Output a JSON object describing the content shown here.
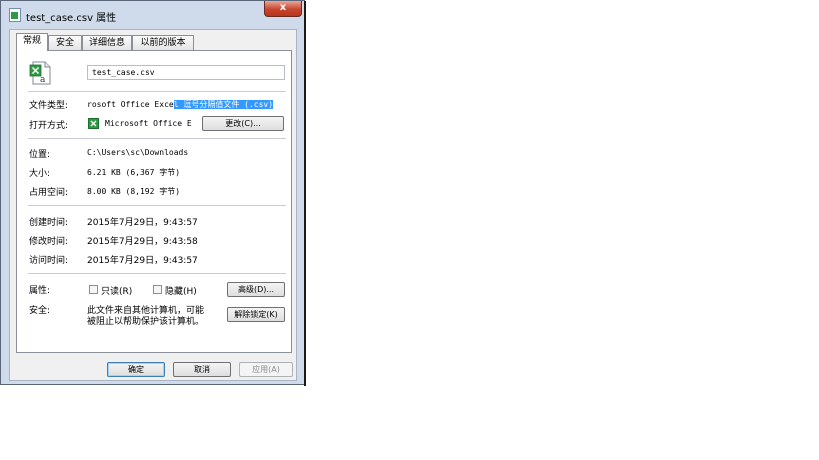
{
  "window": {
    "title": "test_case.csv 属性",
    "close_label": "x"
  },
  "tabs": [
    {
      "label": "常规",
      "active": true
    },
    {
      "label": "安全",
      "active": false
    },
    {
      "label": "详细信息",
      "active": false
    },
    {
      "label": "以前的版本",
      "active": false
    }
  ],
  "file": {
    "name": "test_case.csv",
    "type_label": "文件类型:",
    "type_value_plain": "rosoft Office Exce",
    "type_value_selected": "l 逗号分隔值文件 (.csv)",
    "open_with_label": "打开方式:",
    "open_with_value": "Microsoft Office E",
    "change_button": "更改(C)..."
  },
  "location": {
    "location_label": "位置:",
    "location_value": "C:\\Users\\sc\\Downloads",
    "size_label": "大小:",
    "size_value": "6.21 KB (6,367 字节)",
    "disk_label": "占用空间:",
    "disk_value": "8.00 KB (8,192 字节)"
  },
  "dates": {
    "created_label": "创建时间:",
    "created_value": "2015年7月29日，9:43:57",
    "modified_label": "修改时间:",
    "modified_value": "2015年7月29日，9:43:58",
    "accessed_label": "访问时间:",
    "accessed_value": "2015年7月29日，9:43:57"
  },
  "attributes": {
    "label": "属性:",
    "readonly_label": "只读(R)",
    "readonly_checked": false,
    "hidden_label": "隐藏(H)",
    "hidden_checked": false,
    "advanced_button": "高级(D)..."
  },
  "security": {
    "label": "安全:",
    "text_line1": "此文件来自其他计算机，可能",
    "text_line2": "被阻止以帮助保护该计算机。",
    "unblock_button": "解除锁定(K)"
  },
  "footer": {
    "ok_button": "确定",
    "cancel_button": "取消",
    "apply_button": "应用(A)"
  },
  "colors": {
    "selection": "#3399ff",
    "close_button": "#c7462e",
    "frame": "#cfdbea"
  }
}
